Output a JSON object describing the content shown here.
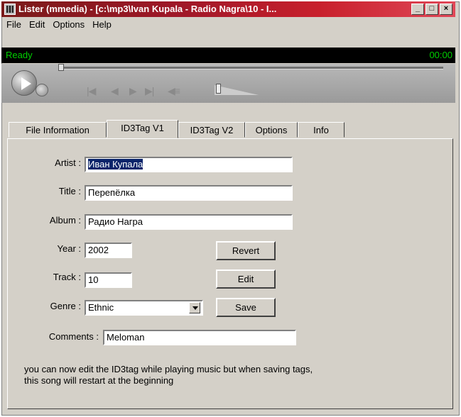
{
  "window": {
    "title": "Lister (mmedia) - [c:\\mp3\\Ivan Kupala - Radio Nagra\\10 - I..."
  },
  "menu": [
    "File",
    "Edit",
    "Options",
    "Help"
  ],
  "status": {
    "text": "Ready",
    "time": "00:00"
  },
  "tabs": [
    "File Information",
    "ID3Tag V1",
    "ID3Tag V2",
    "Options",
    "Info"
  ],
  "form": {
    "artist_label": "Artist :",
    "artist_value": "Иван Купала",
    "title_label": "Title :",
    "title_value": "Перепёлка",
    "album_label": "Album :",
    "album_value": "Радио Награ",
    "year_label": "Year :",
    "year_value": "2002",
    "track_label": "Track :",
    "track_value": "10",
    "genre_label": "Genre :",
    "genre_value": "Ethnic",
    "comments_label": "Comments :",
    "comments_value": "Meloman",
    "note": "you can now edit the ID3tag while playing music but when saving tags, this song will restart at the beginning"
  },
  "buttons": {
    "revert": "Revert",
    "edit": "Edit",
    "save": "Save"
  },
  "colors": {
    "selection": "#0a246a",
    "status_bg": "#000000",
    "status_fg": "#00d000",
    "title_bg": "#a01828"
  }
}
